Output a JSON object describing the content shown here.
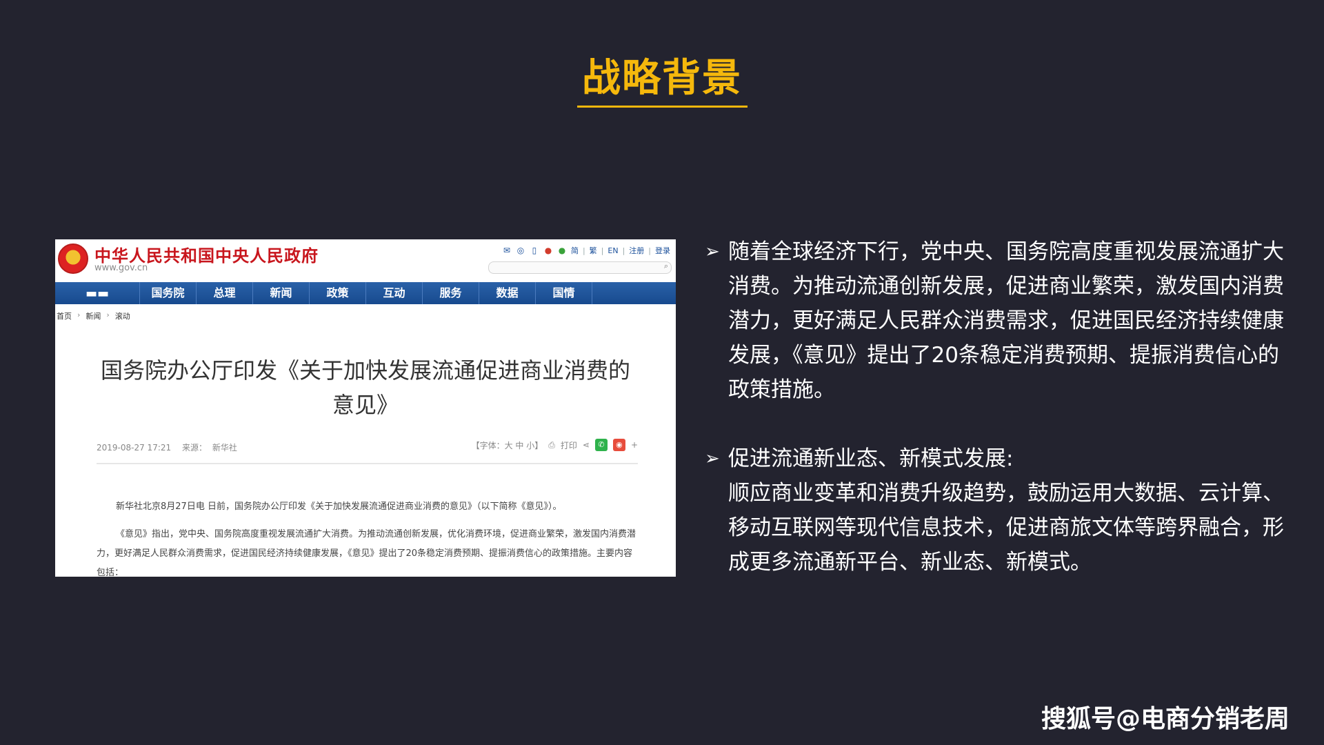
{
  "slide": {
    "title": "战略背景",
    "watermark": "搜狐号@电商分销老周"
  },
  "screenshot": {
    "site_name": "中华人民共和国中央人民政府",
    "site_url": "www.gov.cn",
    "header_links": [
      "简",
      "繁",
      "EN",
      "注册",
      "登录"
    ],
    "nav_items": [
      "国务院",
      "总理",
      "新闻",
      "政策",
      "互动",
      "服务",
      "数据",
      "国情"
    ],
    "breadcrumb": [
      "首页",
      "新闻",
      "滚动"
    ],
    "article_title": "国务院办公厅印发《关于加快发展流通促进商业消费的意见》",
    "meta_date": "2019-08-27 17:21",
    "meta_source_label": "来源：",
    "meta_source": "新华社",
    "font_size_label": "【字体：大 中 小】",
    "print_label": "打印",
    "paragraph_1": "新华社北京8月27日电 日前，国务院办公厅印发《关于加快发展流通促进商业消费的意见》（以下简称《意见》）。",
    "paragraph_2": "《意见》指出，党中央、国务院高度重视发展流通扩大消费。为推动流通创新发展，优化消费环境，促进商业繁荣，激发国内消费潜力，更好满足人民群众消费需求，促进国民经济持续健康发展，《意见》提出了20条稳定消费预期、提振消费信心的政策措施。主要内容包括："
  },
  "bullets": [
    {
      "text": "随着全球经济下行，党中央、国务院高度重视发展流通扩大消费。为推动流通创新发展，促进商业繁荣，激发国内消费潜力，更好满足人民群众消费需求，促进国民经济持续健康发展，《意见》提出了20条稳定消费预期、提振消费信心的政策措施。"
    },
    {
      "heading": "促进流通新业态、新模式发展:",
      "text": "顺应商业变革和消费升级趋势，鼓励运用大数据、云计算、移动互联网等现代信息技术，促进商旅文体等跨界融合，形成更多流通新平台、新业态、新模式。"
    }
  ],
  "colors": {
    "background": "#23232f",
    "title": "#f5b80c",
    "site_red": "#c8161d",
    "nav_blue": "#1f559c"
  }
}
